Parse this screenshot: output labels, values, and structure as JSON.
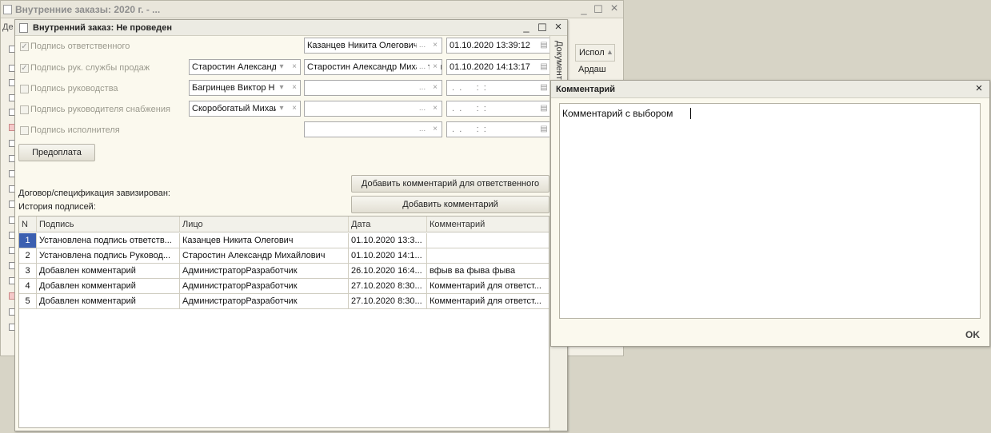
{
  "background_window": {
    "title": "Внутренние заказы: 2020 г. - ...",
    "menu_fragment": "Де",
    "column_fragment": "Испол",
    "cell_fragment": "Ардаш"
  },
  "dialog": {
    "title": "Внутренний заказ: Не проведен",
    "side_tab": "Документ",
    "signatures": [
      {
        "label": "Подпись ответственного",
        "checked": true,
        "person": "",
        "signer": "Казанцев Никита Олегович",
        "datetime": "01.10.2020 13:39:12"
      },
      {
        "label": "Подпись рук. службы продаж",
        "checked": true,
        "person": "Старостин Александр",
        "signer": "Старостин Александр Михайлович",
        "datetime": "01.10.2020 14:13:17"
      },
      {
        "label": "Подпись руководства",
        "checked": false,
        "person": "Багринцев Виктор Н",
        "signer": "",
        "datetime": " .  .      :  :"
      },
      {
        "label": "Подпись руководителя снабжения",
        "checked": false,
        "person": "Скоробогатый Михаил",
        "signer": "",
        "datetime": " .  .      :  :"
      },
      {
        "label": "Подпись исполнителя",
        "checked": false,
        "person": "",
        "signer": "",
        "datetime": " .  .      :  :"
      }
    ],
    "prepay_button": "Предоплата",
    "add_comment_responsible_button": "Добавить комментарий для ответственного",
    "add_comment_button": "Добавить комментарий",
    "contract_label": "Договор/спецификация завизирован:",
    "history_label": "История подписей:",
    "table": {
      "columns": [
        "N",
        "Подпись",
        "Лицо",
        "Дата",
        "Комментарий"
      ],
      "rows": [
        {
          "n": "1",
          "signature": "Установлена подпись ответств...",
          "person": "Казанцев Никита Олегович",
          "date": "01.10.2020 13:3...",
          "comment": ""
        },
        {
          "n": "2",
          "signature": "Установлена подпись Руковод...",
          "person": "Старостин Александр Михайлович",
          "date": "01.10.2020 14:1...",
          "comment": ""
        },
        {
          "n": "3",
          "signature": "Добавлен комментарий",
          "person": "АдминистраторРазработчик",
          "date": "26.10.2020 16:4...",
          "comment": "вфыв ва фыва фыва"
        },
        {
          "n": "4",
          "signature": "Добавлен комментарий",
          "person": "АдминистраторРазработчик",
          "date": "27.10.2020 8:30...",
          "comment": "Комментарий для ответст..."
        },
        {
          "n": "5",
          "signature": "Добавлен комментарий",
          "person": "АдминистраторРазработчик",
          "date": "27.10.2020 8:30...",
          "comment": "Комментарий для ответст..."
        }
      ]
    }
  },
  "comment_popup": {
    "title": "Комментарий",
    "text": "Комментарий с выбором",
    "ok_label": "OK"
  },
  "icons": {
    "close": "×",
    "minimize": "_",
    "maximize": "☐",
    "dropdown": "▾",
    "clear": "×",
    "ellipsis": "...",
    "calendar": "▤",
    "sort_up": "▲"
  },
  "colors": {
    "selection": "#3c5fb0",
    "window_bg": "#fbf9ee",
    "desktop_bg": "#d7d4c6"
  }
}
